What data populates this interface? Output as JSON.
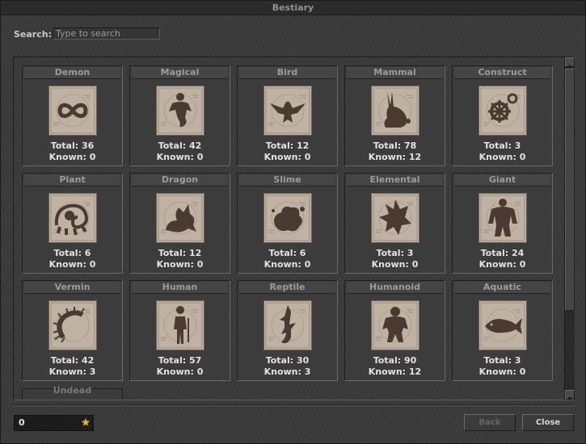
{
  "window": {
    "title": "Bestiary"
  },
  "search": {
    "label": "Search:",
    "placeholder": "Type to search",
    "value": ""
  },
  "cards": [
    {
      "name": "Demon",
      "total": "Total: 36",
      "known": "Known: 0",
      "icon": "infinity-icon"
    },
    {
      "name": "Magical",
      "total": "Total: 42",
      "known": "Known: 0",
      "icon": "genie-icon"
    },
    {
      "name": "Bird",
      "total": "Total: 12",
      "known": "Known: 0",
      "icon": "bird-icon"
    },
    {
      "name": "Mammal",
      "total": "Total: 78",
      "known": "Known: 12",
      "icon": "rabbit-icon"
    },
    {
      "name": "Construct",
      "total": "Total: 3",
      "known": "Known: 0",
      "icon": "gears-icon"
    },
    {
      "name": "Plant",
      "total": "Total: 6",
      "known": "Known: 0",
      "icon": "plant-icon"
    },
    {
      "name": "Dragon",
      "total": "Total: 12",
      "known": "Known: 0",
      "icon": "dragon-icon"
    },
    {
      "name": "Slime",
      "total": "Total: 6",
      "known": "Known: 0",
      "icon": "slime-icon"
    },
    {
      "name": "Elemental",
      "total": "Total: 3",
      "known": "Known: 0",
      "icon": "elemental-icon"
    },
    {
      "name": "Giant",
      "total": "Total: 24",
      "known": "Known: 0",
      "icon": "giant-icon"
    },
    {
      "name": "Vermin",
      "total": "Total: 42",
      "known": "Known: 3",
      "icon": "centipede-icon"
    },
    {
      "name": "Human",
      "total": "Total: 57",
      "known": "Known: 0",
      "icon": "human-icon"
    },
    {
      "name": "Reptile",
      "total": "Total: 30",
      "known": "Known: 3",
      "icon": "lizard-icon"
    },
    {
      "name": "Humanoid",
      "total": "Total: 90",
      "known": "Known: 12",
      "icon": "humanoid-icon"
    },
    {
      "name": "Aquatic",
      "total": "Total: 3",
      "known": "Known: 0",
      "icon": "fish-icon"
    }
  ],
  "partial_card": {
    "name": "Undead"
  },
  "footer": {
    "coins": "0",
    "back_label": "Back",
    "close_label": "Close"
  },
  "colors": {
    "parchment": "#bfb2a2",
    "silhouette": "#4a3a32",
    "panel": "#3a3a3a"
  }
}
